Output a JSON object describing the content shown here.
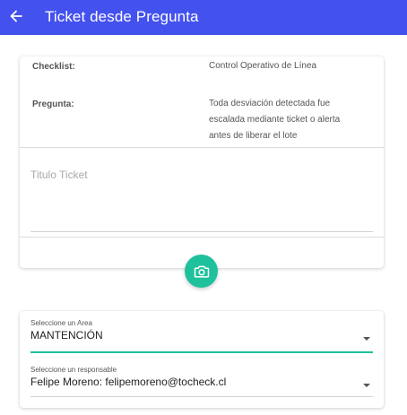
{
  "app_bar": {
    "title": "Ticket desde Pregunta",
    "color": "#4351ef",
    "back_icon": "arrow-left-icon"
  },
  "ticket_card": {
    "checklist_label": "Checklist:",
    "checklist_value": "Control Operativo de Línea",
    "pregunta_label": "Pregunta:",
    "pregunta_value_lines": [
      "Toda desviación detectada fue",
      "escalada mediante ticket o alerta",
      "antes de liberar el lote"
    ],
    "titulo_input": {
      "placeholder": "Titulo Ticket",
      "value": ""
    }
  },
  "camera_button": {
    "icon": "camera-icon",
    "color": "#1fc19d"
  },
  "area_card": {
    "area_select": {
      "label": "Seleccione un Area",
      "value": "MANTENCIÓN",
      "underline_color": "#1fc19d"
    },
    "responsable_select": {
      "label": "Seleccione un responsable",
      "value": "Felipe Moreno: felipemoreno@tocheck.cl"
    }
  }
}
